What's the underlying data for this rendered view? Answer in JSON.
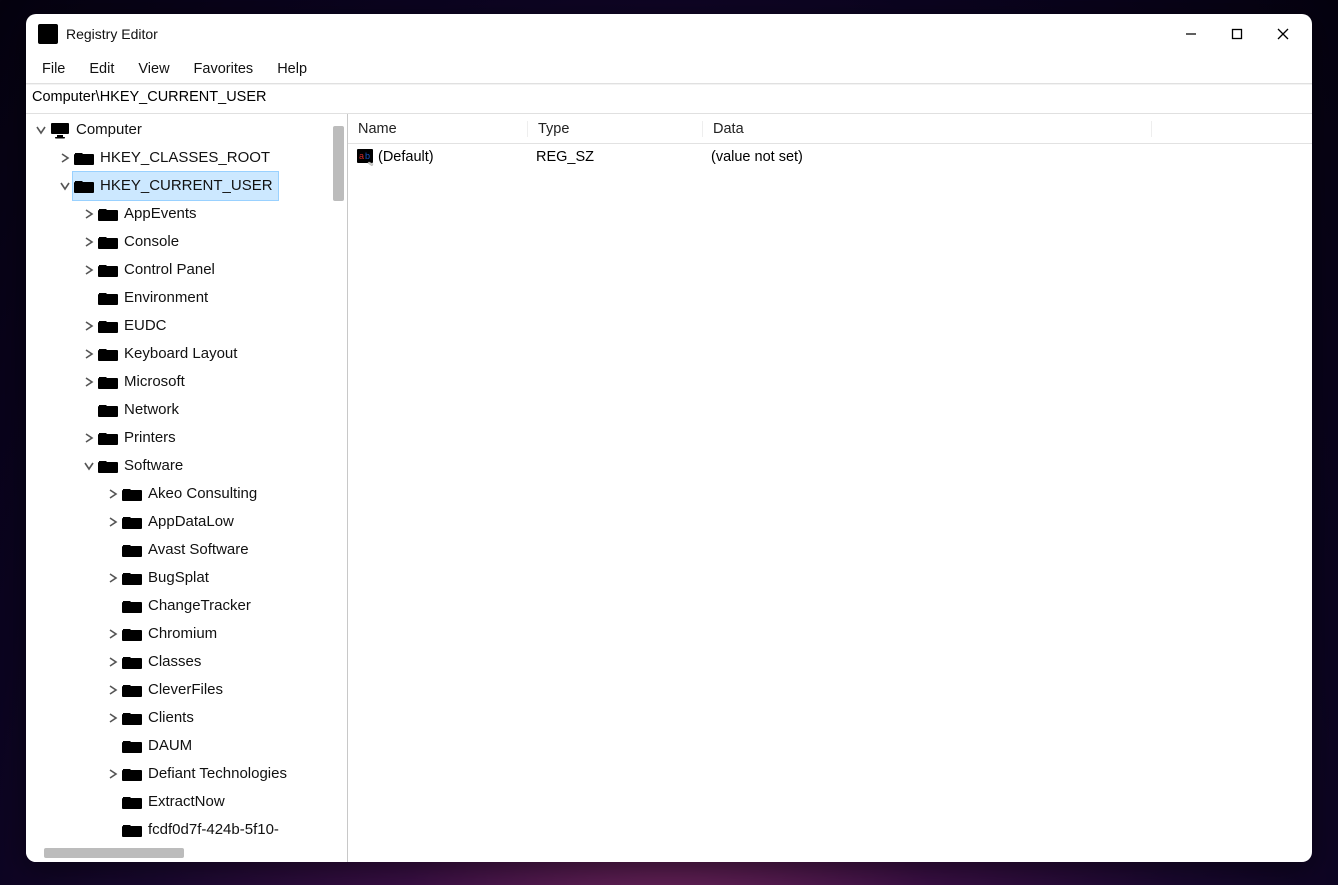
{
  "titlebar": {
    "title": "Registry Editor"
  },
  "menubar": {
    "items": [
      "File",
      "Edit",
      "View",
      "Favorites",
      "Help"
    ]
  },
  "addressbar": {
    "path": "Computer\\HKEY_CURRENT_USER"
  },
  "tree": {
    "root_label": "Computer",
    "root_expanded": true,
    "hives": [
      {
        "label": "HKEY_CLASSES_ROOT",
        "expandable": true,
        "expanded": false
      },
      {
        "label": "HKEY_CURRENT_USER",
        "expandable": true,
        "expanded": true,
        "selected": true,
        "children": [
          {
            "label": "AppEvents",
            "expandable": true,
            "expanded": false
          },
          {
            "label": "Console",
            "expandable": true,
            "expanded": false
          },
          {
            "label": "Control Panel",
            "expandable": true,
            "expanded": false
          },
          {
            "label": "Environment",
            "expandable": false
          },
          {
            "label": "EUDC",
            "expandable": true,
            "expanded": false
          },
          {
            "label": "Keyboard Layout",
            "expandable": true,
            "expanded": false
          },
          {
            "label": "Microsoft",
            "expandable": true,
            "expanded": false
          },
          {
            "label": "Network",
            "expandable": false
          },
          {
            "label": "Printers",
            "expandable": true,
            "expanded": false
          },
          {
            "label": "Software",
            "expandable": true,
            "expanded": true,
            "children": [
              {
                "label": "Akeo Consulting",
                "expandable": true,
                "expanded": false
              },
              {
                "label": "AppDataLow",
                "expandable": true,
                "expanded": false
              },
              {
                "label": "Avast Software",
                "expandable": false
              },
              {
                "label": "BugSplat",
                "expandable": true,
                "expanded": false
              },
              {
                "label": "ChangeTracker",
                "expandable": false
              },
              {
                "label": "Chromium",
                "expandable": true,
                "expanded": false
              },
              {
                "label": "Classes",
                "expandable": true,
                "expanded": false
              },
              {
                "label": "CleverFiles",
                "expandable": true,
                "expanded": false
              },
              {
                "label": "Clients",
                "expandable": true,
                "expanded": false
              },
              {
                "label": "DAUM",
                "expandable": false
              },
              {
                "label": "Defiant Technologies",
                "expandable": true,
                "expanded": false
              },
              {
                "label": "ExtractNow",
                "expandable": false
              },
              {
                "label": "fcdf0d7f-424b-5f10-",
                "expandable": false
              }
            ]
          }
        ]
      }
    ]
  },
  "list": {
    "columns": [
      "Name",
      "Type",
      "Data"
    ],
    "rows": [
      {
        "name": "(Default)",
        "type": "REG_SZ",
        "data": "(value not set)"
      }
    ]
  }
}
